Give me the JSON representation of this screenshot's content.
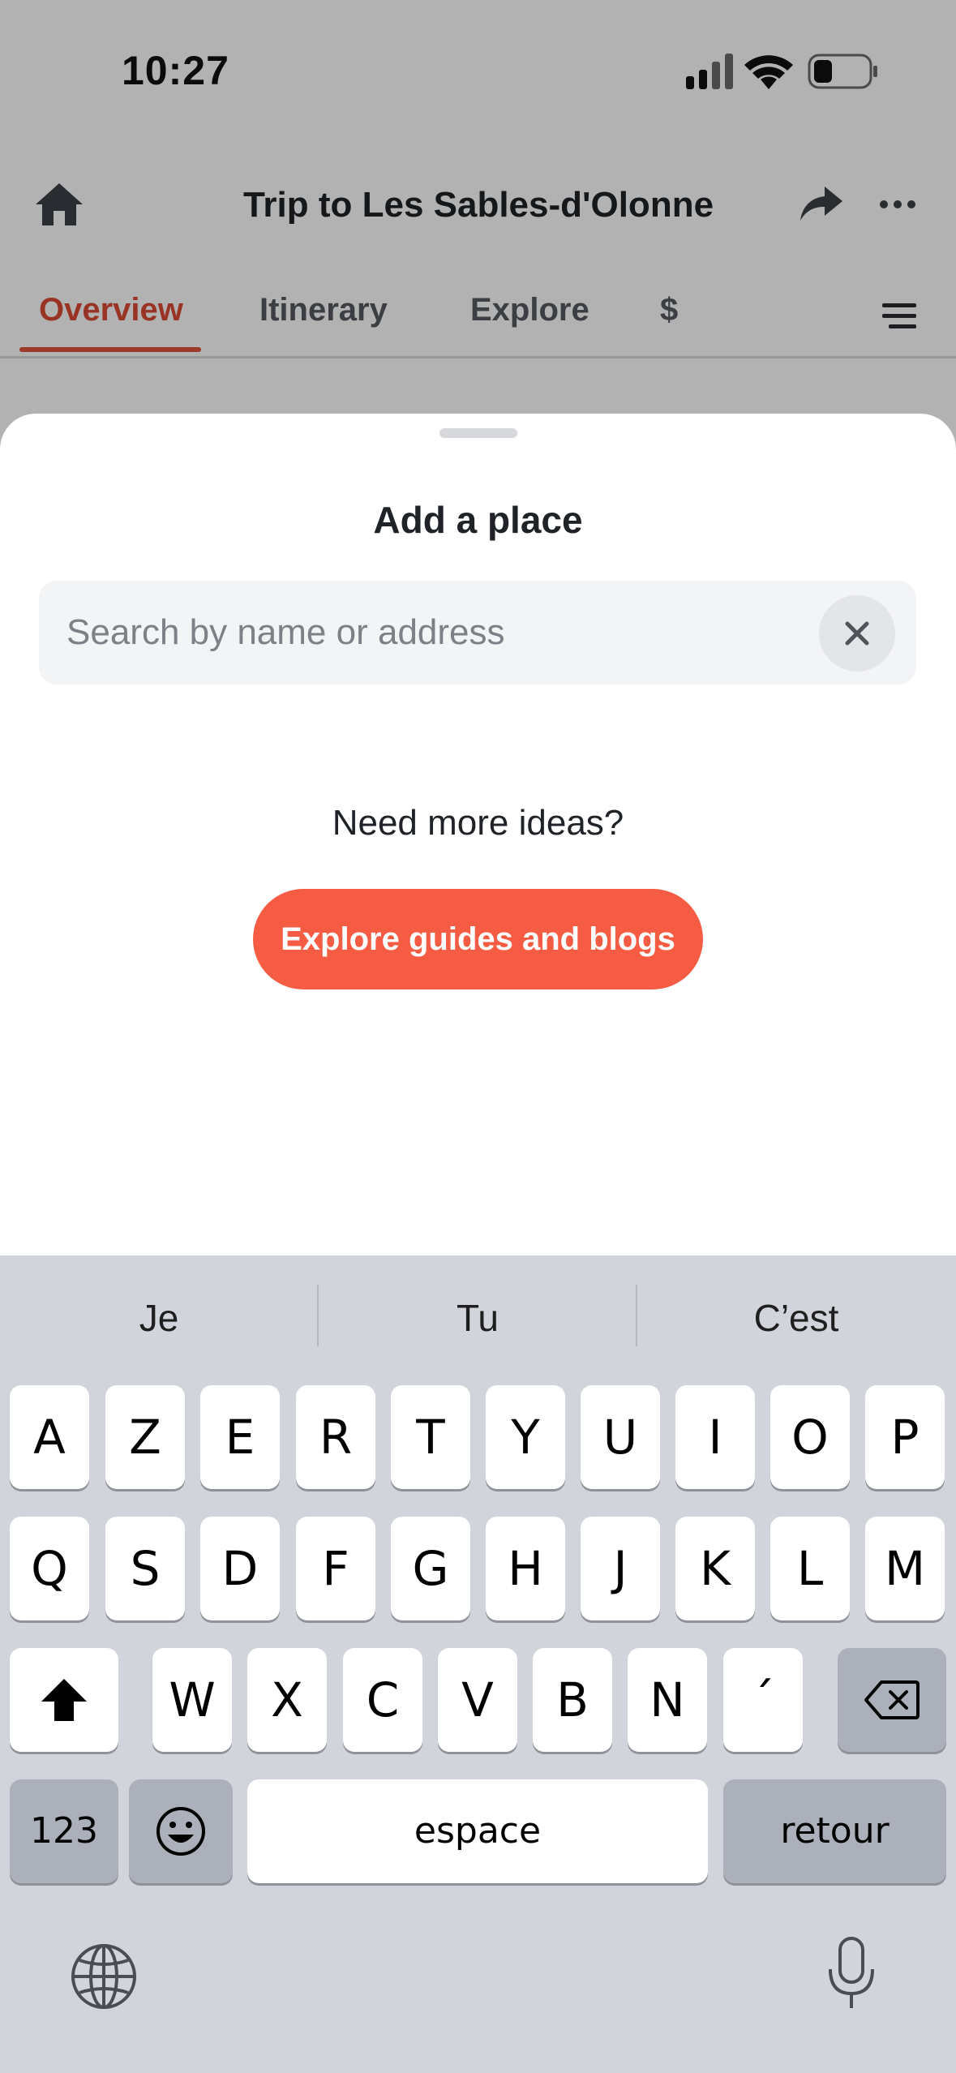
{
  "status_bar": {
    "time": "10:27"
  },
  "header": {
    "title": "Trip to Les Sables-d'Olonne"
  },
  "tabs": [
    {
      "label": "Overview",
      "active": true
    },
    {
      "label": "Itinerary",
      "active": false
    },
    {
      "label": "Explore",
      "active": false
    },
    {
      "label": "$",
      "active": false
    }
  ],
  "sheet": {
    "title": "Add a place",
    "search_placeholder": "Search by name or address",
    "ideas_text": "Need more ideas?",
    "explore_button": "Explore guides and blogs"
  },
  "keyboard": {
    "suggestions": [
      "Je",
      "Tu",
      "C’est"
    ],
    "row1": [
      "A",
      "Z",
      "E",
      "R",
      "T",
      "Y",
      "U",
      "I",
      "O",
      "P"
    ],
    "row2": [
      "Q",
      "S",
      "D",
      "F",
      "G",
      "H",
      "J",
      "K",
      "L",
      "M"
    ],
    "row3": [
      "W",
      "X",
      "C",
      "V",
      "B",
      "N",
      "´"
    ],
    "numbers_key": "123",
    "space_key": "espace",
    "return_key": "retour"
  },
  "colors": {
    "accent": "#f65c44",
    "active_tab": "#dc4b35",
    "keyboard_bg": "#d1d4db"
  }
}
